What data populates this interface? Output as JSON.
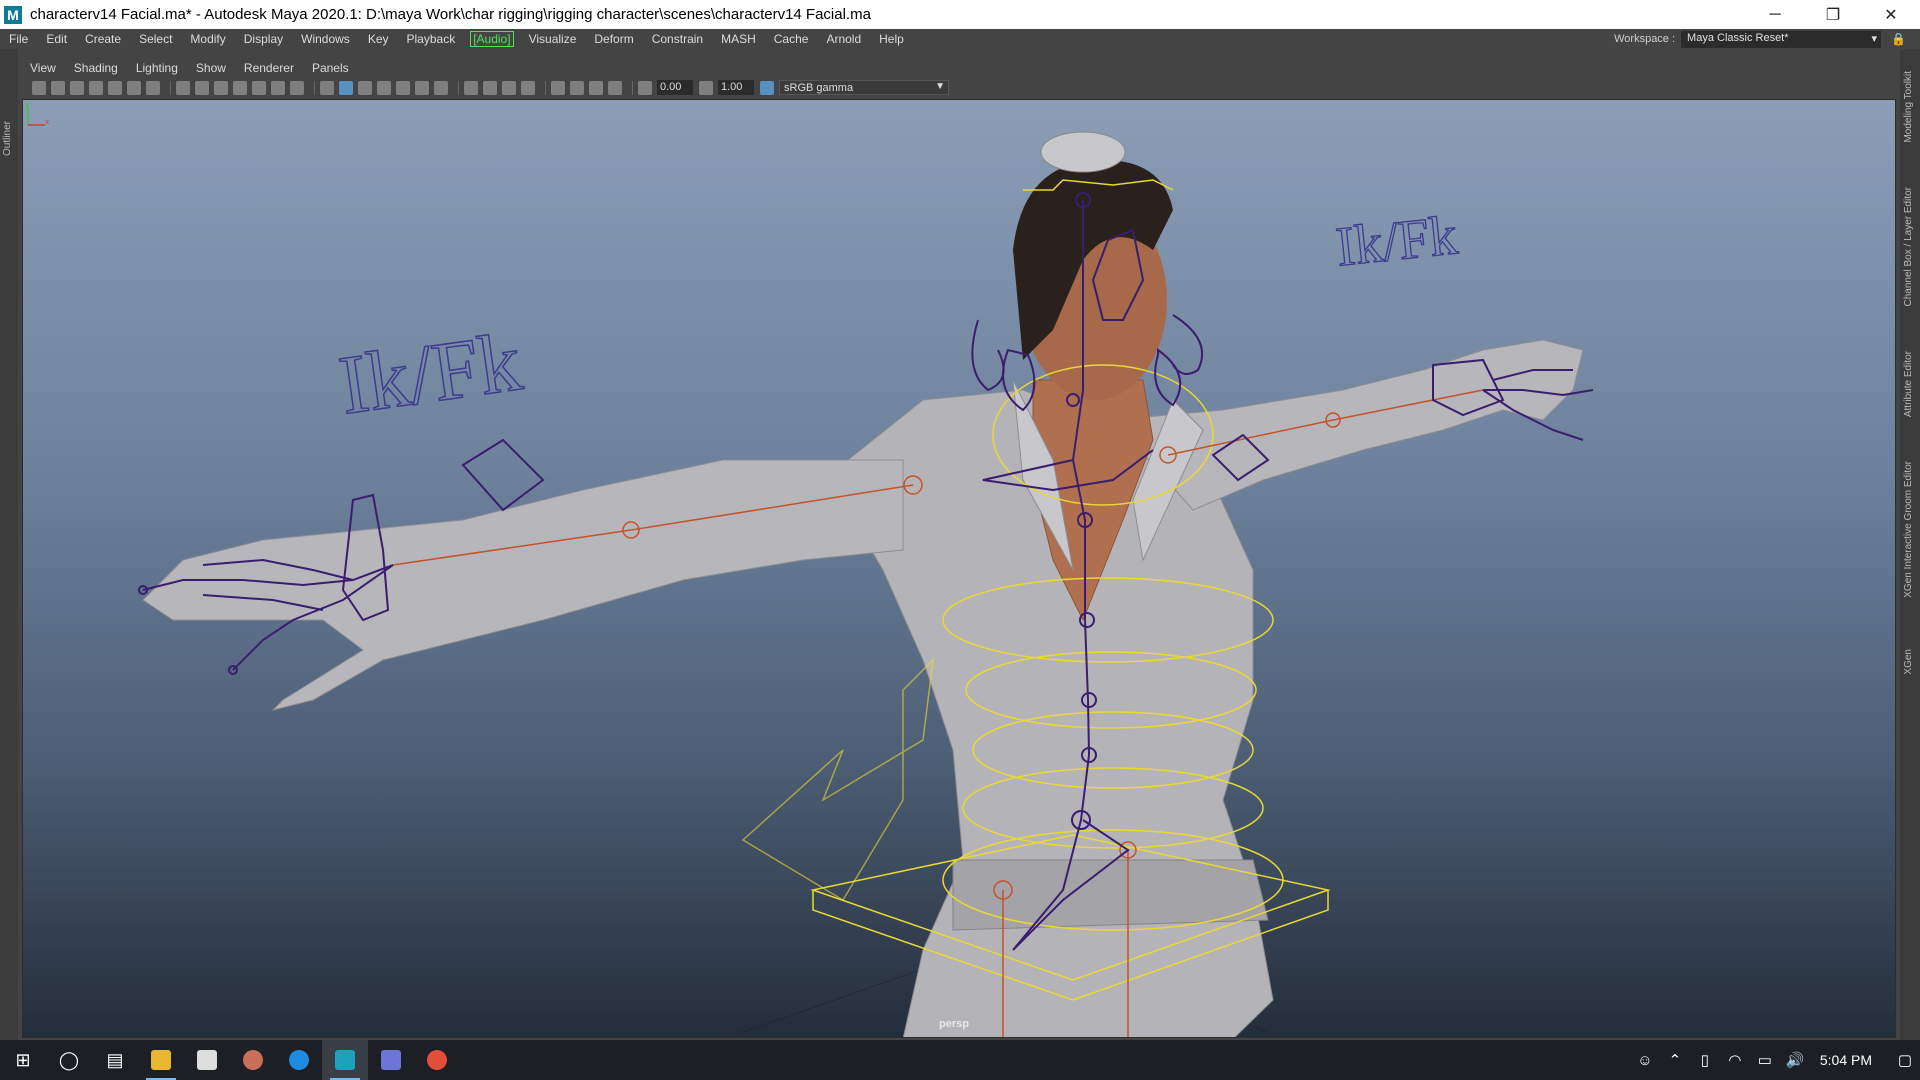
{
  "window": {
    "app_icon": "M",
    "title": "characterv14 Facial.ma* - Autodesk Maya 2020.1: D:\\maya Work\\char rigging\\rigging character\\scenes\\characterv14 Facial.ma",
    "controls": {
      "minimize": "─",
      "restore": "❐",
      "close": "✕"
    }
  },
  "menu": {
    "items": [
      "File",
      "Edit",
      "Create",
      "Select",
      "Modify",
      "Display",
      "Windows",
      "Key",
      "Playback",
      "Audio",
      "Visualize",
      "Deform",
      "Constrain",
      "MASH",
      "Cache",
      "Arnold",
      "Help"
    ],
    "audio_label": "[Audio]",
    "workspace_label": "Workspace :",
    "workspace_value": "Maya Classic Reset*"
  },
  "left_strip": {
    "outliner": "Outliner"
  },
  "right_strip": {
    "tabs": [
      "Modeling Toolkit",
      "Channel Box / Layer Editor",
      "Attribute Editor",
      "XGen Interactive Groom Editor",
      "XGen"
    ]
  },
  "panel_menu": {
    "items": [
      "View",
      "Shading",
      "Lighting",
      "Show",
      "Renderer",
      "Panels"
    ]
  },
  "viewport_toolbar": {
    "exposure": "0.00",
    "gamma": "1.00",
    "color_space": "sRGB gamma"
  },
  "viewport": {
    "camera": "persp",
    "ikfk_left": "Ik/Fk",
    "ikfk_right": "Ik/Fk",
    "axis_labels": {
      "x": "x",
      "y": "y"
    }
  },
  "taskbar": {
    "apps": [
      "windows-start",
      "cortana-search",
      "task-view",
      "file-explorer",
      "contacts",
      "paint",
      "edge",
      "maya",
      "discord",
      "chrome"
    ],
    "clock": "5:04 PM"
  },
  "colors": {
    "viewport_top": "#8c9eb6",
    "viewport_bottom": "#242d3a",
    "joint_purple": "#3b1d6e",
    "control_yellow": "#e8d833",
    "ik_orange": "#c4532a",
    "audio_green": "#4fe05a"
  }
}
